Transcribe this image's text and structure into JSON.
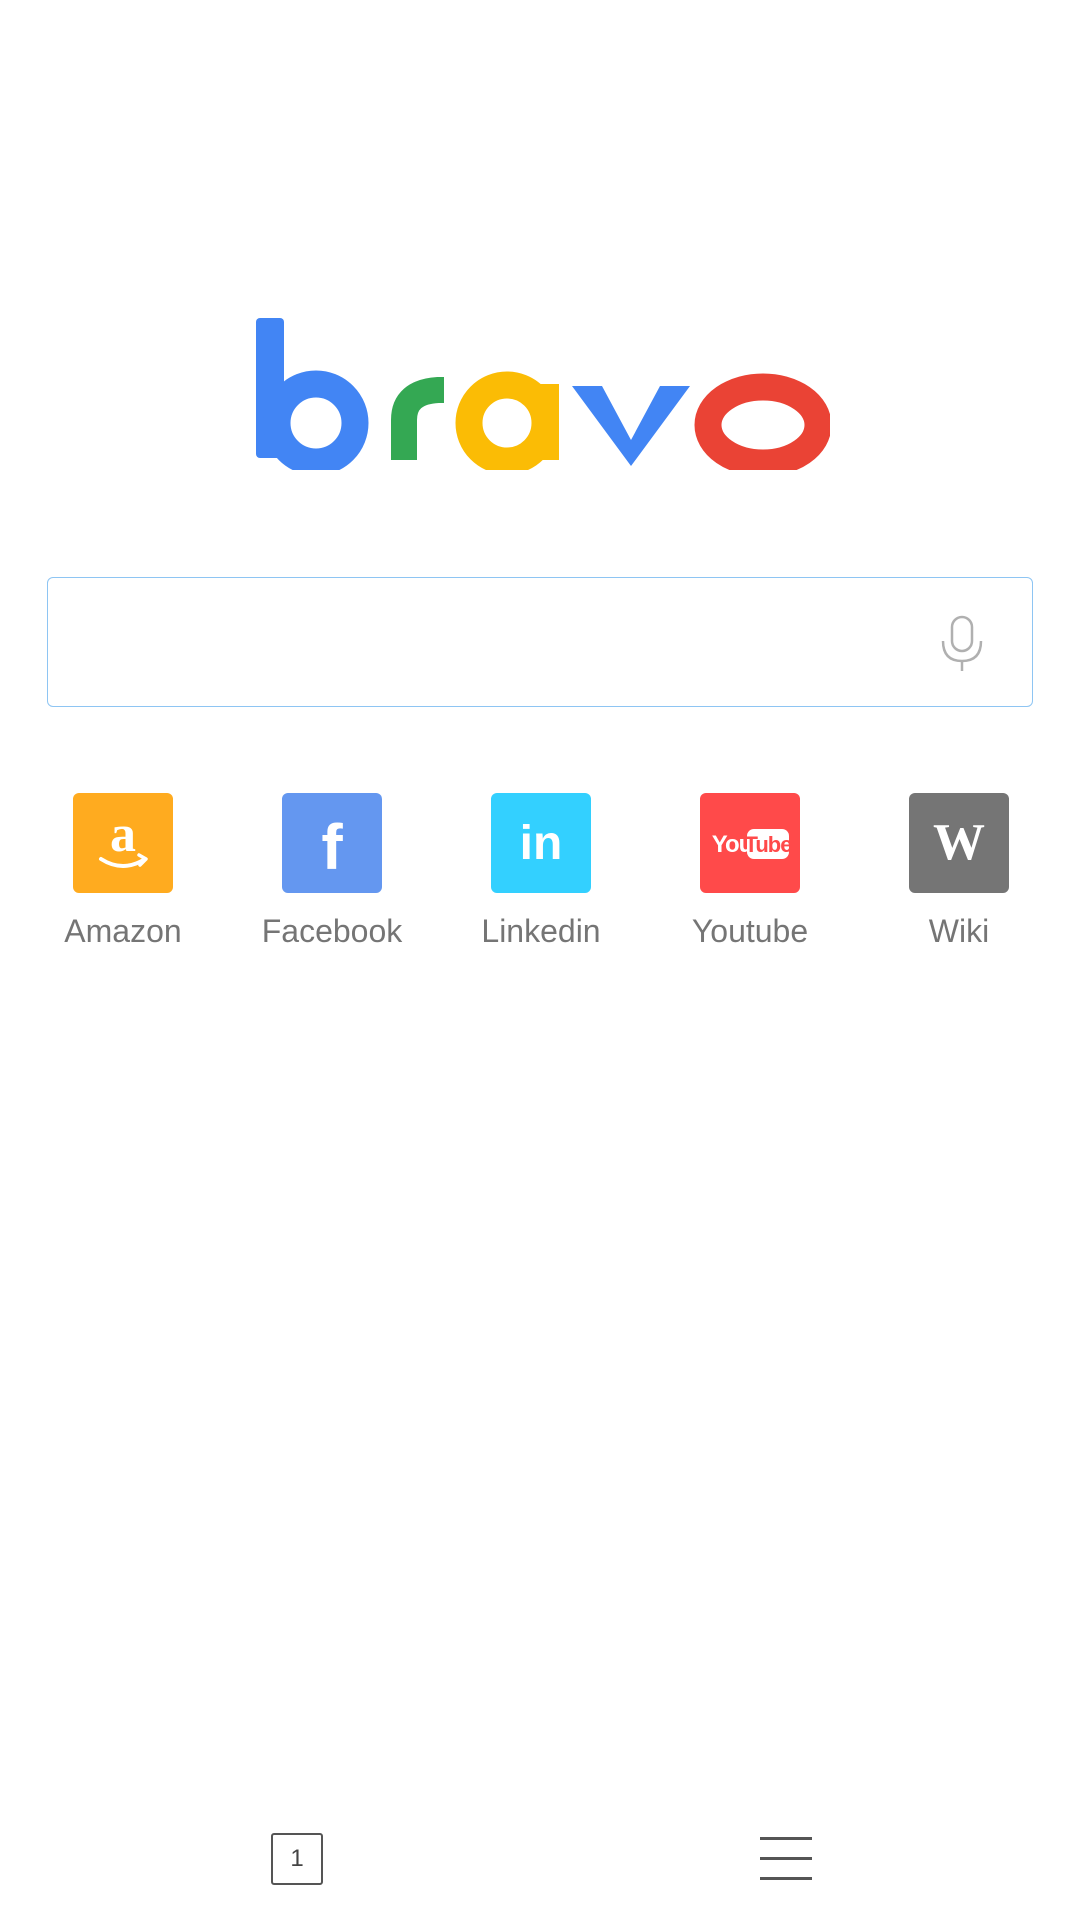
{
  "logo": {
    "letters": [
      {
        "char": "b",
        "color": "#4285F4"
      },
      {
        "char": "r",
        "color": "#34A853"
      },
      {
        "char": "a",
        "color": "#FBBC05"
      },
      {
        "char": "v",
        "color": "#4285F4"
      },
      {
        "char": "o",
        "color": "#EA4335"
      }
    ]
  },
  "search": {
    "value": "",
    "placeholder": "",
    "mic_icon": "microphone-icon",
    "border_color": "#8ec5f3"
  },
  "shortcuts": [
    {
      "label": "Amazon",
      "icon": "amazon-icon",
      "color": "#FFAB1F"
    },
    {
      "label": "Facebook",
      "icon": "facebook-icon",
      "color": "#6497F0"
    },
    {
      "label": "Linkedin",
      "icon": "linkedin-icon",
      "color": "#33D0FF"
    },
    {
      "label": "Youtube",
      "icon": "youtube-icon",
      "color": "#FF4A4A"
    },
    {
      "label": "Wiki",
      "icon": "wikipedia-icon",
      "color": "#757575"
    }
  ],
  "bottom_bar": {
    "tab_count": "1",
    "menu_icon": "hamburger-menu-icon"
  }
}
